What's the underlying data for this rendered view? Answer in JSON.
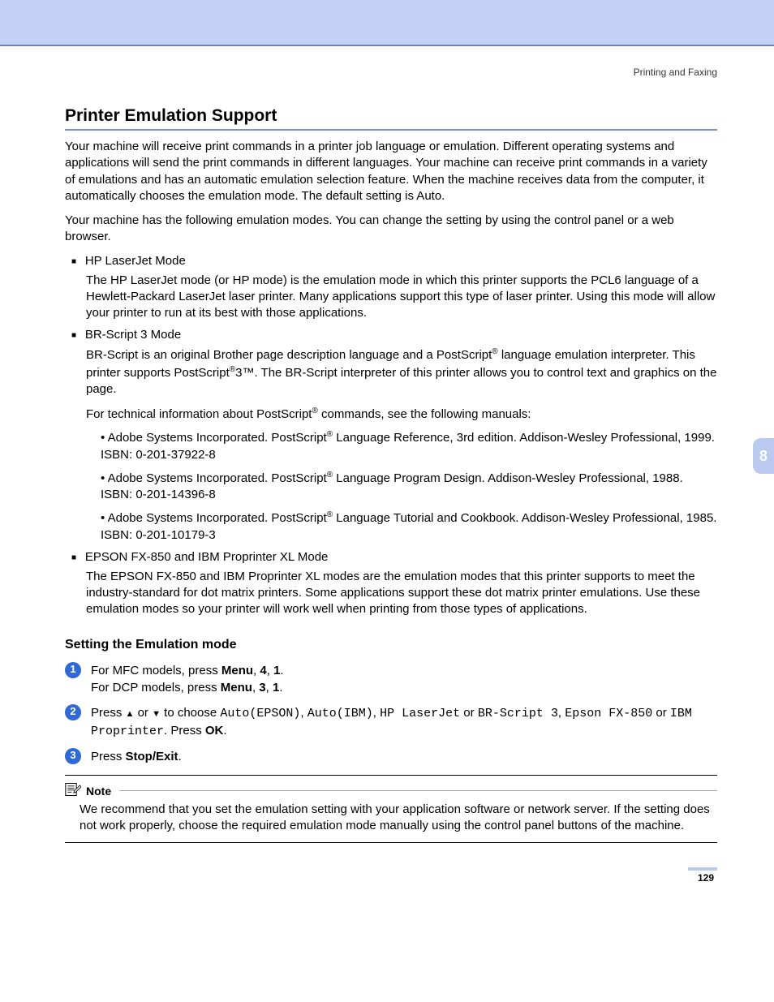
{
  "breadcrumb": "Printing and Faxing",
  "title": "Printer Emulation Support",
  "intro1": "Your machine will receive print commands in a printer job language or emulation. Different operating systems and applications will send the print commands in different languages. Your machine can receive print commands in a variety of emulations and has an automatic emulation selection feature. When the machine receives data from the computer, it automatically chooses the emulation mode. The default setting is Auto.",
  "intro2": "Your machine has the following emulation modes. You can change the setting by using the control panel or a web browser.",
  "modes": {
    "hp": {
      "title": "HP LaserJet Mode",
      "desc": "The HP LaserJet mode (or HP mode) is the emulation mode in which this printer supports the PCL6 language of a Hewlett-Packard LaserJet laser printer. Many applications support this type of laser printer. Using this mode will allow your printer to run at its best with those applications."
    },
    "br": {
      "title": "BR-Script 3 Mode",
      "desc1a": "BR-Script is an original Brother page description language and a PostScript",
      "desc1b": " language emulation interpreter. This printer supports PostScript",
      "desc1c": "3™. The BR-Script interpreter of this printer allows you to control text and graphics on the page.",
      "desc2a": "For technical information about PostScript",
      "desc2b": " commands, see the following manuals:",
      "refs": {
        "r1a": "Adobe Systems Incorporated. PostScript",
        "r1b": " Language Reference, 3rd edition. Addison-Wesley Professional, 1999. ISBN: 0-201-37922-8",
        "r2a": "Adobe Systems Incorporated. PostScript",
        "r2b": " Language Program Design. Addison-Wesley Professional, 1988. ISBN: 0-201-14396-8",
        "r3a": "Adobe Systems Incorporated. PostScript",
        "r3b": " Language Tutorial and Cookbook. Addison-Wesley Professional, 1985. ISBN: 0-201-10179-3"
      }
    },
    "epson": {
      "title": "EPSON FX-850 and IBM Proprinter XL Mode",
      "desc": "The EPSON FX-850 and IBM Proprinter XL modes are the emulation modes that this printer supports to meet the industry-standard for dot matrix printers. Some applications support these dot matrix printer emulations. Use these emulation modes so your printer will work well when printing from those types of applications."
    }
  },
  "subheading": "Setting the Emulation mode",
  "steps": {
    "s1a": "For MFC models, press ",
    "s1b": "Menu",
    "s1c": ", ",
    "s1d": "4",
    "s1e": ", ",
    "s1f": "1",
    "s1g": ".",
    "s1h": "For DCP models, press ",
    "s1i": "Menu",
    "s1j": ", ",
    "s1k": "3",
    "s1l": ", ",
    "s1m": "1",
    "s1n": ".",
    "s2a": "Press ",
    "s2b": " or ",
    "s2c": " to choose ",
    "s2opt1": "Auto(EPSON)",
    "s2opt2": "Auto(IBM)",
    "s2opt3": "HP LaserJet",
    "s2or": " or ",
    "s2opt4": "BR-Script 3",
    "s2opt5": "Epson FX-850",
    "s2d": " or ",
    "s2opt6": "IBM Proprinter",
    "s2e": ". Press ",
    "s2f": "OK",
    "s2g": ".",
    "s3a": "Press ",
    "s3b": "Stop/Exit",
    "s3c": "."
  },
  "note": {
    "label": "Note",
    "body": "We recommend that you set the emulation setting with your application software or network server. If the setting does not work properly, choose the required emulation mode manually using the control panel buttons of the machine."
  },
  "tab": "8",
  "page": "129",
  "sep": ", "
}
